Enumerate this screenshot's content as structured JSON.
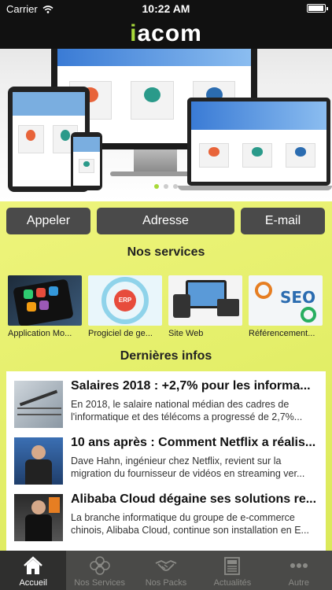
{
  "status_bar": {
    "carrier": "Carrier",
    "time": "10:22 AM",
    "battery_level": 0.95
  },
  "brand": {
    "logo_prefix": "i",
    "logo_rest": "acom",
    "accent": "#a8d93a"
  },
  "carousel": {
    "pages": 3,
    "active_index": 0
  },
  "actions": {
    "call_label": "Appeler",
    "address_label": "Adresse",
    "email_label": "E-mail"
  },
  "services": {
    "title": "Nos services",
    "items": [
      {
        "label": "Application Mo..."
      },
      {
        "label": "Progiciel de ge..."
      },
      {
        "label": "Site Web"
      },
      {
        "label": "Référencement..."
      }
    ]
  },
  "news": {
    "title": "Dernières infos",
    "items": [
      {
        "title": "Salaires 2018 : +2,7% pour les informa...",
        "desc": "En 2018, le salaire national médian des cadres de l'informatique et des télécoms a progressé de 2,7%..."
      },
      {
        "title": "10 ans après : Comment Netflix a réalis...",
        "desc": "Dave Hahn, ingénieur chez Netflix, revient sur la migration du fournisseur de vidéos en streaming ver..."
      },
      {
        "title": "Alibaba Cloud dégaine ses solutions re...",
        "desc": "La branche informatique du groupe de e-commerce chinois, Alibaba Cloud, continue son installation en E..."
      }
    ]
  },
  "tabs": [
    {
      "label": "Accueil",
      "icon": "home-icon",
      "active": true
    },
    {
      "label": "Nos Services",
      "icon": "flower-icon",
      "active": false
    },
    {
      "label": "Nos Packs",
      "icon": "handshake-icon",
      "active": false
    },
    {
      "label": "Actualités",
      "icon": "newspaper-icon",
      "active": false
    },
    {
      "label": "Autre",
      "icon": "more-icon",
      "active": false
    }
  ]
}
